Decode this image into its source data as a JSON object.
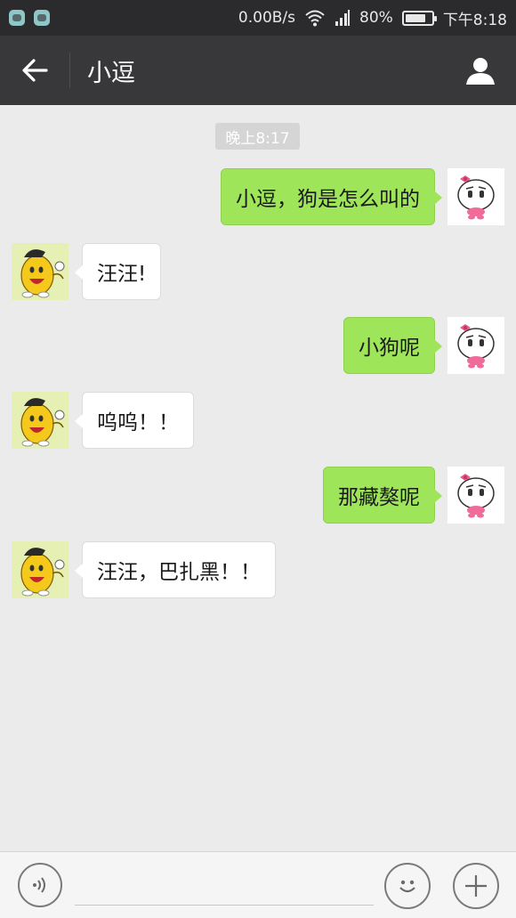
{
  "status_bar": {
    "network_speed": "0.00B/s",
    "battery_percent": "80%",
    "battery_level": 0.8,
    "time": "下午8:18",
    "icons": [
      "app-icon-1",
      "app-icon-2",
      "wifi-icon",
      "signal-icon",
      "battery-icon"
    ]
  },
  "header": {
    "back_icon": "arrow-left-icon",
    "title": "小逗",
    "profile_icon": "person-icon"
  },
  "chat": {
    "timestamp": "晚上8:17",
    "messages": [
      {
        "side": "right",
        "text": "小逗，狗是怎么叫的"
      },
      {
        "side": "left",
        "text": "汪汪!"
      },
      {
        "side": "right",
        "text": "小狗呢"
      },
      {
        "side": "left",
        "text": "呜呜！！"
      },
      {
        "side": "right",
        "text": "那藏獒呢"
      },
      {
        "side": "left",
        "text": "汪汪，巴扎黑！！"
      }
    ]
  },
  "input_bar": {
    "voice_icon": "voice-icon",
    "input_value": "",
    "emoji_icon": "emoji-icon",
    "plus_icon": "plus-icon"
  },
  "colors": {
    "header_bg": "#38383a",
    "status_bg": "#2b2b2d",
    "chat_bg": "#ebebeb",
    "outgoing_bubble": "#9ee55a",
    "incoming_bubble": "#ffffff"
  }
}
